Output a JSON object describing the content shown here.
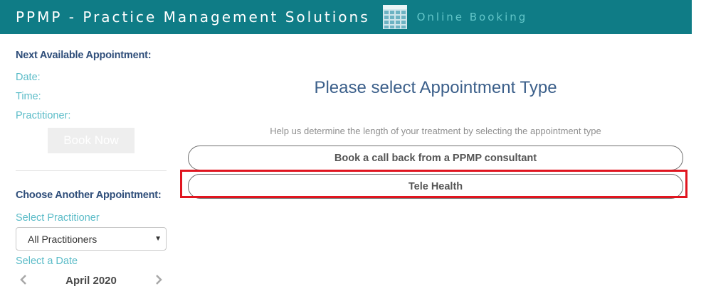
{
  "header": {
    "brand": "PPMP - Practice Management Solutions",
    "subtitle": "Online Booking",
    "icon": "calendar-icon",
    "colors": {
      "background": "#0f7c86",
      "brand_text": "#ffffff",
      "subtitle_text": "#63c6c9"
    }
  },
  "sidebar": {
    "next_heading": "Next Available Appointment:",
    "date_label": "Date:",
    "time_label": "Time:",
    "practitioner_label": "Practitioner:",
    "book_now": "Book Now",
    "choose_heading": "Choose Another Appointment:",
    "select_practitioner_label": "Select Practitioner",
    "practitioner_select": {
      "selected": "All Practitioners"
    },
    "select_date_label": "Select a Date",
    "calendar": {
      "month": "April 2020",
      "prev_icon": "chevron-left-icon",
      "next_icon": "chevron-right-icon"
    }
  },
  "main": {
    "title": "Please select Appointment Type",
    "subtitle": "Help us determine the length of your treatment by selecting the appointment type",
    "options": [
      {
        "label": "Book a call back from a PPMP consultant"
      },
      {
        "label": "Tele Health",
        "highlighted": true
      }
    ],
    "highlight_color": "#e0151f"
  }
}
